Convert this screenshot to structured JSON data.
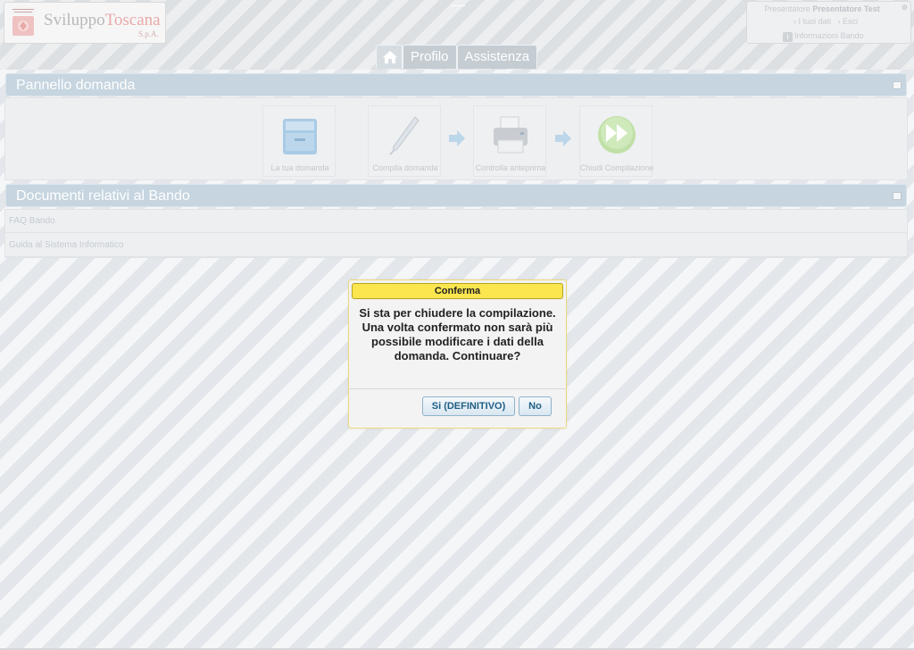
{
  "logo": {
    "name_part1": "Sviluppo",
    "name_part2": "Toscana",
    "suffix": "S.p.A.",
    "emblem_icon": "regione-toscana-emblem"
  },
  "user_box": {
    "presenter_label": "Presentatore",
    "presenter_name": "Presentatore Test",
    "my_data_link": "› I tuoi dati",
    "logout_link": "› Esci",
    "info_link": "Informazioni Bando",
    "close_icon": "gear-icon"
  },
  "nav": {
    "home_icon": "home-icon",
    "tabs": [
      {
        "label": "Profilo"
      },
      {
        "label": "Assistenza"
      }
    ]
  },
  "panel_domanda": {
    "title": "Pannello domanda",
    "steps": [
      {
        "label": "La tua domanda",
        "icon": "file-cabinet-icon"
      },
      {
        "label": "Compila domanda",
        "icon": "pen-icon"
      },
      {
        "label": "Controlla anteprima",
        "icon": "printer-icon"
      },
      {
        "label": "Chiudi Compilazione",
        "icon": "fast-forward-icon"
      }
    ]
  },
  "panel_documenti": {
    "title": "Documenti relativi al Bando",
    "items": [
      {
        "label": "FAQ Bando"
      },
      {
        "label": "Guida al Sistema Informatico"
      }
    ]
  },
  "dialog": {
    "title": "Conferma",
    "message": "Si sta per chiudere la compilazione. Una volta confermato non sarà più possibile modificare i dati della domanda. Continuare?",
    "confirm_label": "Si (DEFINITIVO)",
    "cancel_label": "No"
  },
  "colors": {
    "dialog_title_bg": "#fbe64f",
    "button_text": "#1f5e85",
    "panel_header_bg": "#c6d5df"
  }
}
